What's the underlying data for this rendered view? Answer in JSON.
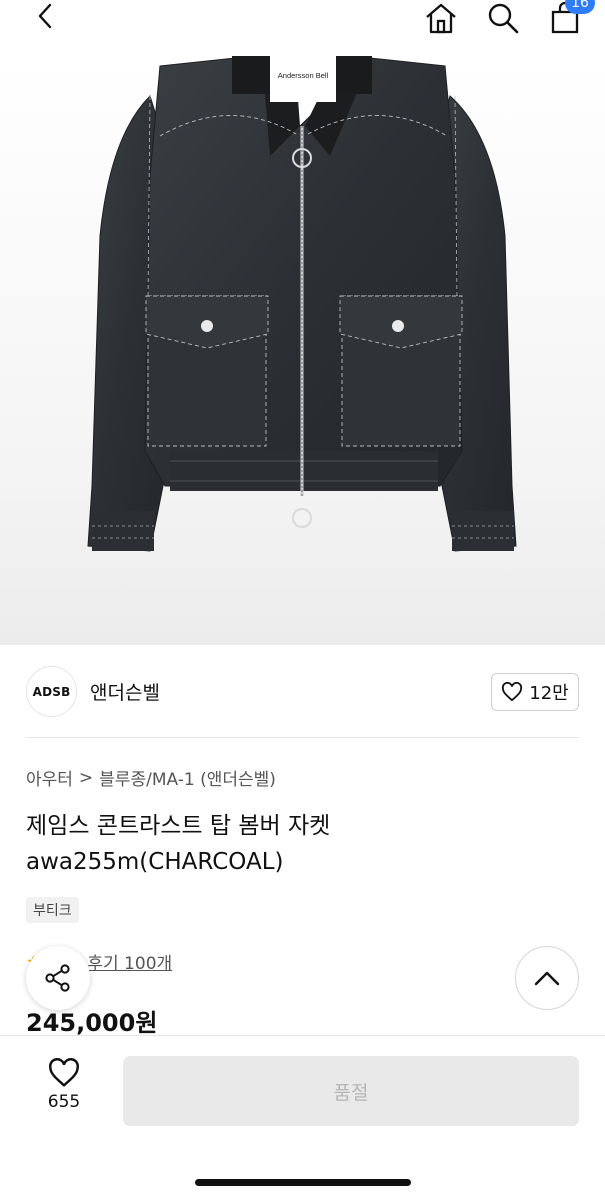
{
  "header": {
    "cart_count": "16"
  },
  "product_image": {
    "label_text": "Andersson Bell"
  },
  "brand": {
    "logo_text": "ADSB",
    "name": "앤더슨벨",
    "like_count": "12만"
  },
  "breadcrumb": {
    "parent": "아우터",
    "separator": ">",
    "category": "블루종/MA-1 (앤더슨벨)"
  },
  "product": {
    "title": "제임스 콘트라스트 탑 봄버 자켓 awa255m(CHARCOAL)",
    "tag": "부티크",
    "review_link": "후기 100개",
    "price": "245,000원"
  },
  "bottom_bar": {
    "wish_count": "655",
    "buy_label": "품절"
  },
  "colors": {
    "accent": "#2f7dff",
    "star": "#f5b400",
    "disabled_bg": "#e9e9e9",
    "disabled_text": "#b5b5b5"
  }
}
